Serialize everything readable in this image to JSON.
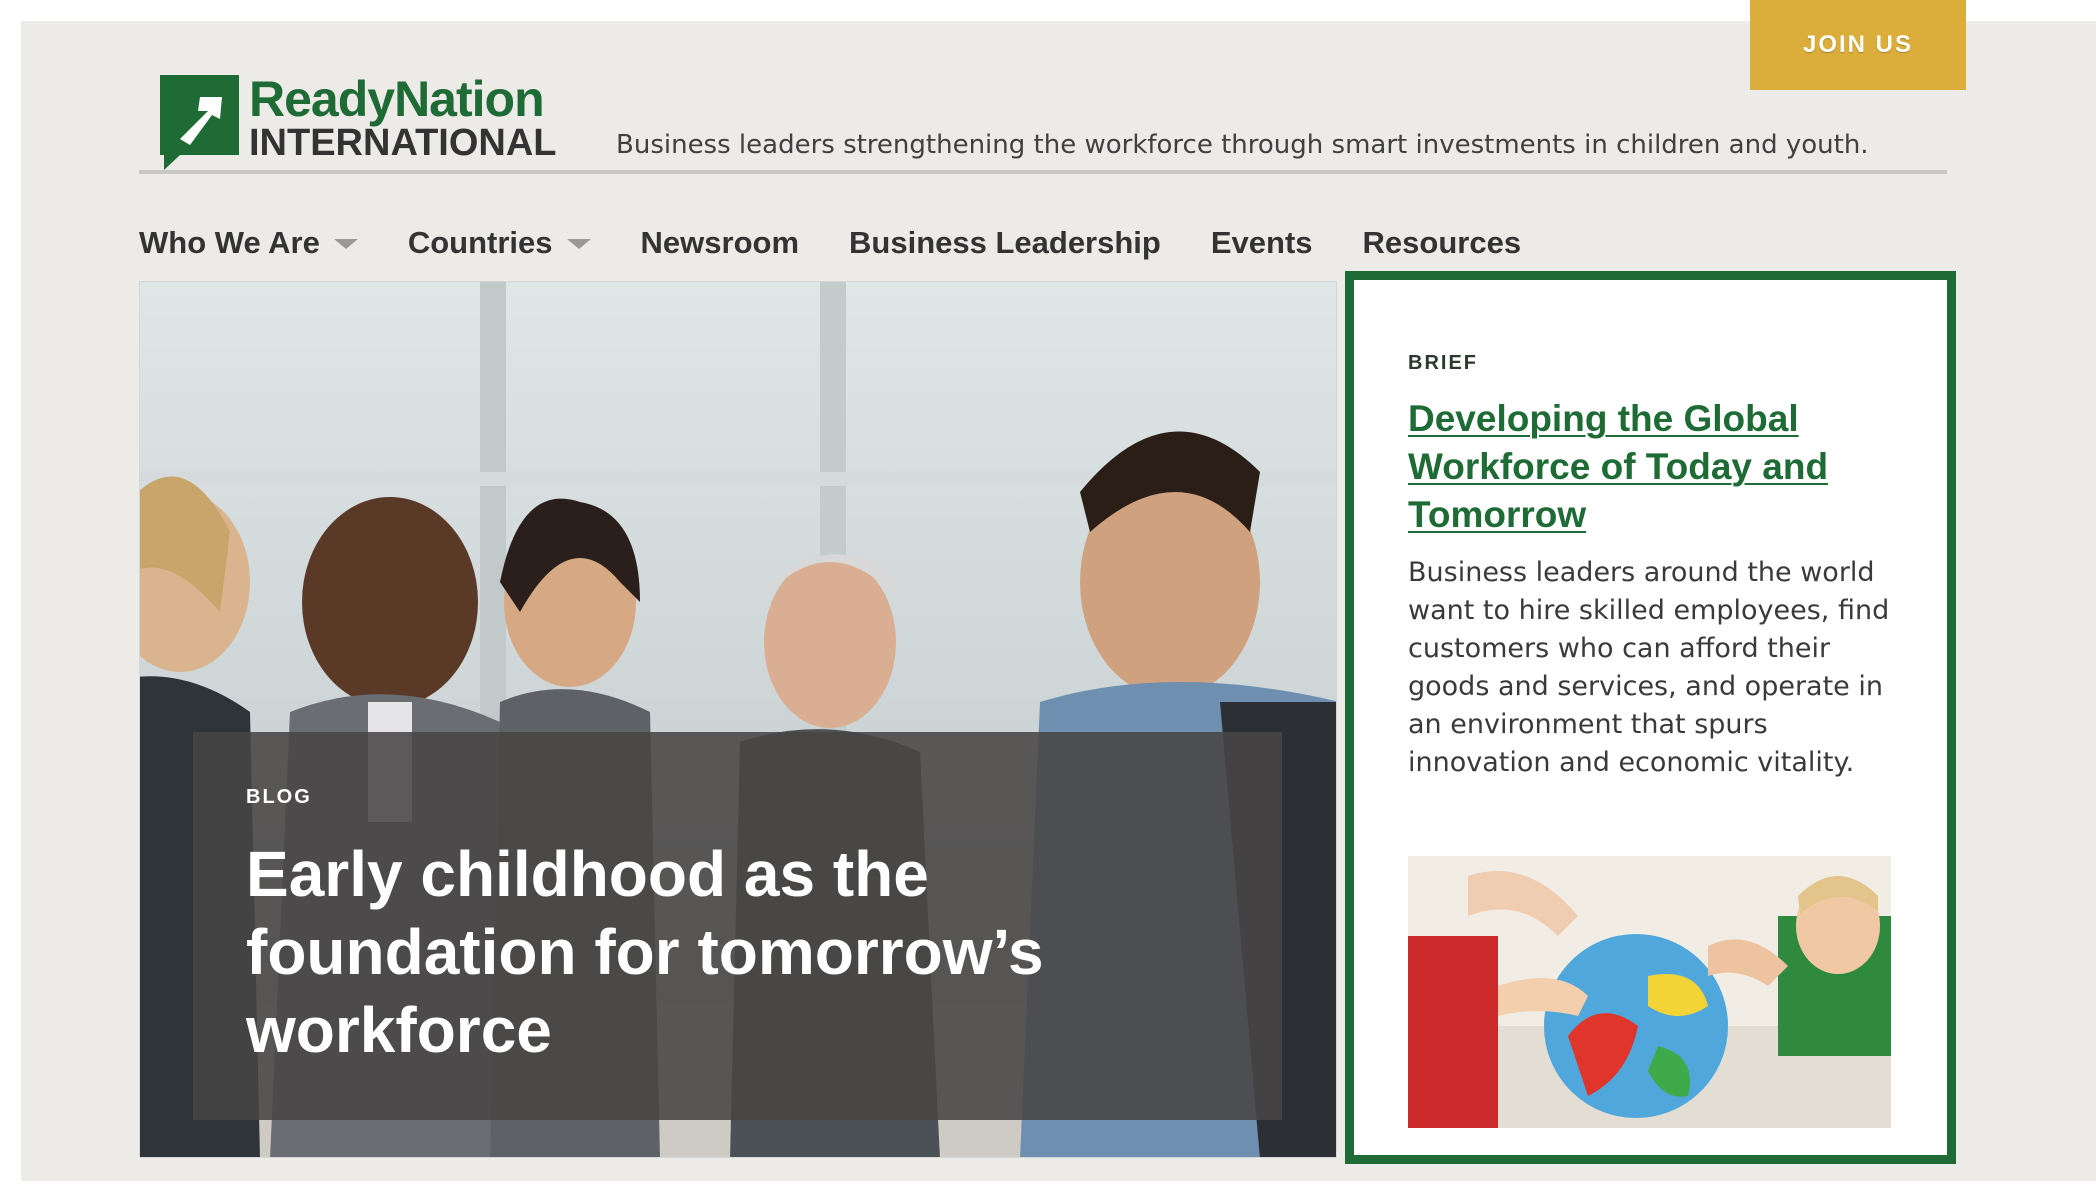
{
  "header": {
    "join_label": "JOIN US",
    "logo": {
      "line1": "ReadyNation",
      "line2": "INTERNATIONAL"
    },
    "tagline": "Business leaders strengthening the workforce through smart investments in children and youth."
  },
  "nav": {
    "items": [
      {
        "label": "Who We Are",
        "has_dropdown": true
      },
      {
        "label": "Countries",
        "has_dropdown": true
      },
      {
        "label": "Newsroom",
        "has_dropdown": false
      },
      {
        "label": "Business Leadership",
        "has_dropdown": false
      },
      {
        "label": "Events",
        "has_dropdown": false
      },
      {
        "label": "Resources",
        "has_dropdown": false
      }
    ]
  },
  "hero": {
    "category": "BLOG",
    "title": "Early childhood as the foundation for tomorrow’s workforce"
  },
  "brief": {
    "category": "BRIEF",
    "title": "Developing the Global Workforce of Today and Tomorrow",
    "body": "Business leaders around the world want to hire skilled employees, find customers who can afford their goods and services, and operate in an environment that spurs innovation and economic vitality."
  },
  "colors": {
    "brand_green": "#1f6b35",
    "join_gold": "#dbad3a",
    "page_bg": "#edebe8",
    "text_dark": "#333333"
  }
}
